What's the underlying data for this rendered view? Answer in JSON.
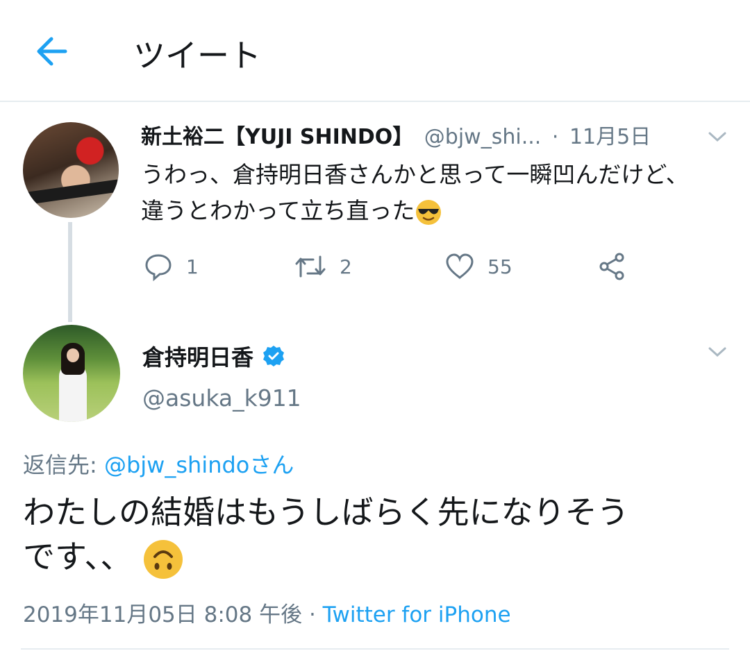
{
  "header": {
    "title": "ツイート",
    "back_icon": "arrow-left-icon"
  },
  "parent_tweet": {
    "name": "新土裕二【YUJI SHINDO】",
    "handle": "@bjw_shi...",
    "separator": "·",
    "date": "11月5日",
    "text_line1": "うわっ、倉持明日香さんかと思って一瞬凹んだけど、",
    "text_line2": "違うとわかって立ち直った",
    "emoji": "smiling-face-with-sunglasses",
    "actions": {
      "reply_count": "1",
      "retweet_count": "2",
      "like_count": "55"
    }
  },
  "main_tweet": {
    "name": "倉持明日香",
    "verified": true,
    "handle": "@asuka_k911",
    "reply_label": "返信先: ",
    "reply_mention": "@bjw_shindoさん",
    "text_line1": "わたしの結婚はもうしばらく先になりそう",
    "text_line2": "です、、",
    "emoji": "upside-down-face",
    "timestamp": "2019年11月05日 8:08 午後",
    "separator": " · ",
    "source": "Twitter for iPhone"
  },
  "colors": {
    "accent": "#1da1f2",
    "secondary_text": "#657786",
    "primary_text": "#14171a",
    "divider": "#e6ecf0",
    "emoji_yellow": "#f5c13b"
  }
}
